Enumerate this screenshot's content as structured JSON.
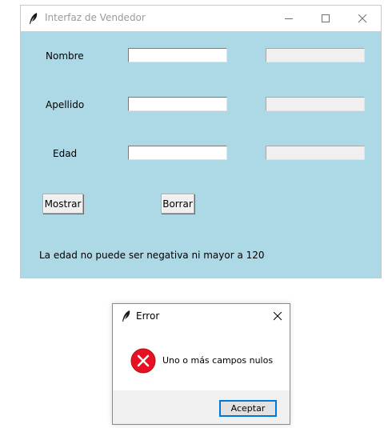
{
  "main_window": {
    "title": "Interfaz de Vendedor",
    "fields": [
      {
        "label": "Nombre",
        "value": "",
        "output": ""
      },
      {
        "label": "Apellido",
        "value": "",
        "output": ""
      },
      {
        "label": "Edad",
        "value": "",
        "output": ""
      }
    ],
    "buttons": {
      "show_label": "Mostrar",
      "clear_label": "Borrar"
    },
    "status_message": "La edad no puede ser negativa ni mayor a 120",
    "background_color": "#add8e6"
  },
  "error_dialog": {
    "title": "Error",
    "icon": "error-icon",
    "message": "Uno o más campos nulos",
    "ok_label": "Aceptar",
    "accent_color": "#0078d7",
    "error_color": "#e81123"
  }
}
